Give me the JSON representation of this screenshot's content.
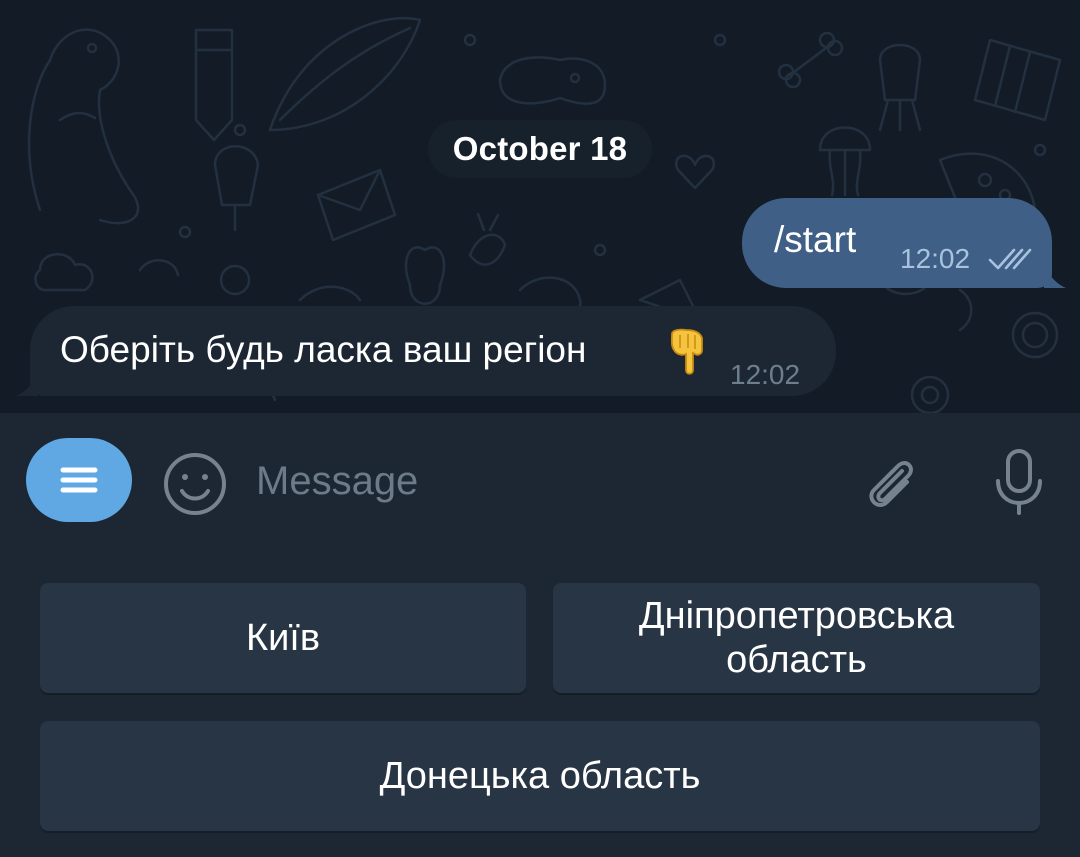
{
  "chat": {
    "date_separator": "October 18",
    "messages": [
      {
        "direction": "outgoing",
        "text": "/start",
        "time": "12:02",
        "status": "read"
      },
      {
        "direction": "incoming",
        "text": "Оберіть будь ласка ваш регіон",
        "emoji": "backhand-index-pointing-down",
        "time": "12:02"
      }
    ]
  },
  "composer": {
    "placeholder": "Message",
    "menu_icon": "menu-icon",
    "emoji_icon": "smiley-icon",
    "attach_icon": "paperclip-icon",
    "mic_icon": "microphone-icon"
  },
  "reply_keyboard": {
    "rows": [
      [
        "Київ",
        "Дніпропетровська область"
      ],
      [
        "Донецька область"
      ]
    ]
  },
  "colors": {
    "chat_background": "#131c26",
    "outgoing_bubble": "#3f5f86",
    "incoming_bubble": "#1d2733",
    "panel": "#1c2733",
    "keyboard_button": "#283544",
    "accent": "#5fa8e3"
  }
}
